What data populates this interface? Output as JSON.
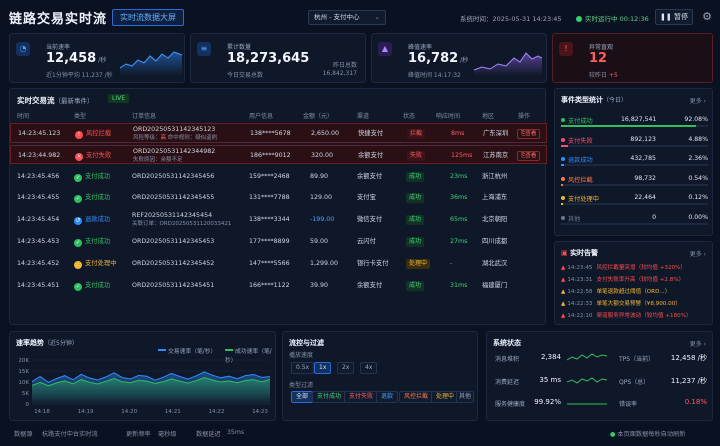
{
  "header": {
    "title": "链路交易实时流",
    "tag": "实时流数据大屏",
    "region": "杭州 - 支付中心",
    "system_time_label": "系统时间：",
    "system_time": "2025-05-31 14:23:45",
    "running_label": "实时运行中",
    "running_time": "00:12:36",
    "pause_label": "暂停"
  },
  "kpis": [
    {
      "label": "当前速率",
      "value": "12,458",
      "unit": "/秒",
      "sub": "近1分钟平均  11,237 /秒",
      "icon": "speed-icon",
      "color": "#2f8cff"
    },
    {
      "label": "累计数量",
      "value": "18,273,645",
      "unit": "",
      "sub": "今日交易总数",
      "right_label": "昨日总数",
      "right_value": "16,842,317",
      "icon": "database-icon",
      "color": "#2f8cff"
    },
    {
      "label": "峰值速率",
      "value": "16,782",
      "unit": "/秒",
      "sub": "峰值时间  14:17:32",
      "icon": "peak-icon",
      "color": "#9b6cff"
    },
    {
      "label": "异常直观",
      "value": "12",
      "unit": "",
      "sub": "较昨日",
      "delta": "+5",
      "icon": "alert-icon",
      "color": "#ff4d4f"
    }
  ],
  "live": {
    "title": "实时交易流",
    "subtitle": "（最新事件）",
    "badge": "LIVE",
    "columns": [
      "时间",
      "类型",
      "订单信息",
      "用户信息",
      "金额（元）",
      "渠道",
      "状态",
      "响应时间",
      "地区",
      "操作"
    ],
    "rows": [
      {
        "time": "14:23:45.123",
        "type": "风控拦截",
        "tcolor": "#ff4d4f",
        "tglyph": "!",
        "order": "ORD20250531142345123",
        "note_pre": "风险等级：",
        "note_hl": "高",
        "note_post": "  命中规则：疑似盗刷",
        "user": "138****5678",
        "amount": "2,650.00",
        "channel": "快捷支付",
        "status": "拦截",
        "sclass": "p-bad",
        "resp": "8ms",
        "rcolor": "#ff5d5d",
        "region": "广东深圳",
        "op": "查看",
        "bad": true
      },
      {
        "time": "14:23:44.982",
        "type": "支付失败",
        "tcolor": "#ff4d4f",
        "tglyph": "✕",
        "order": "ORD20250531142344982",
        "note_pre": "失败原因：余额不足",
        "note_hl": "",
        "note_post": "",
        "user": "186****9012",
        "amount": "320.00",
        "channel": "余额支付",
        "status": "失败",
        "sclass": "p-bad",
        "resp": "125ms",
        "rcolor": "#ff5d5d",
        "region": "江苏南京",
        "op": "查看",
        "bad": true
      },
      {
        "time": "14:23:45.456",
        "type": "支付成功",
        "tcolor": "#2fbf5f",
        "tglyph": "✓",
        "order": "ORD20250531142345456",
        "note_pre": "",
        "note_hl": "",
        "note_post": "",
        "user": "159****2468",
        "amount": "89.90",
        "channel": "余额支付",
        "status": "成功",
        "sclass": "p-ok",
        "resp": "23ms",
        "rcolor": "#3fd47b",
        "region": "浙江杭州",
        "op": "",
        "bad": false
      },
      {
        "time": "14:23:45.455",
        "type": "支付成功",
        "tcolor": "#2fbf5f",
        "tglyph": "✓",
        "order": "ORD20250531142345455",
        "note_pre": "",
        "note_hl": "",
        "note_post": "",
        "user": "131****7788",
        "amount": "129.00",
        "channel": "支付宝",
        "status": "成功",
        "sclass": "p-ok",
        "resp": "36ms",
        "rcolor": "#3fd47b",
        "region": "上海浦东",
        "op": "",
        "bad": false
      },
      {
        "time": "14:23:45.454",
        "type": "退款成功",
        "tcolor": "#2f8cff",
        "tglyph": "↺",
        "order": "REF20250531142345454",
        "note_pre": "关联订单：ORD20250531120033421",
        "note_hl": "",
        "note_post": "",
        "user": "138****3344",
        "amount": "-199.00",
        "acolor": "#4da3ff",
        "channel": "微信支付",
        "status": "成功",
        "sclass": "p-ok",
        "resp": "65ms",
        "rcolor": "#3fd47b",
        "region": "北京朝阳",
        "op": "",
        "bad": false
      },
      {
        "time": "14:23:45.453",
        "type": "支付成功",
        "tcolor": "#2fbf5f",
        "tglyph": "✓",
        "order": "ORD20250531142345453",
        "note_pre": "",
        "note_hl": "",
        "note_post": "",
        "user": "177****8899",
        "amount": "59.00",
        "channel": "云闪付",
        "status": "成功",
        "sclass": "p-ok",
        "resp": "27ms",
        "rcolor": "#3fd47b",
        "region": "四川成都",
        "op": "",
        "bad": false
      },
      {
        "time": "14:23:45.452",
        "type": "支付处理中",
        "tcolor": "#f2b531",
        "tglyph": "…",
        "order": "ORD20250531142345452",
        "note_pre": "",
        "note_hl": "",
        "note_post": "",
        "user": "147****5566",
        "amount": "1,299.00",
        "channel": "银行卡支付",
        "status": "处理中",
        "sclass": "p-warn",
        "resp": "-",
        "rcolor": "#9aa7bf",
        "region": "湖北武汉",
        "op": "",
        "bad": false
      },
      {
        "time": "14:23:45.451",
        "type": "支付成功",
        "tcolor": "#2fbf5f",
        "tglyph": "✓",
        "order": "ORD20250531142345451",
        "note_pre": "",
        "note_hl": "",
        "note_post": "",
        "user": "166****1122",
        "amount": "39.90",
        "channel": "余额支付",
        "status": "成功",
        "sclass": "p-ok",
        "resp": "31ms",
        "rcolor": "#3fd47b",
        "region": "福建厦门",
        "op": "",
        "bad": false
      }
    ]
  },
  "stats": {
    "title": "事件类型统计",
    "subtitle": "（今日）",
    "more": "更多 ›",
    "items": [
      {
        "name": "支付成功",
        "count": "16,827,541",
        "pct": "92.08%",
        "color": "#2fbf5f",
        "frac": 0.9208
      },
      {
        "name": "支付失败",
        "count": "892,123",
        "pct": "4.88%",
        "color": "#ff4d6d",
        "frac": 0.0488
      },
      {
        "name": "退款成功",
        "count": "432,785",
        "pct": "2.36%",
        "color": "#2f8cff",
        "frac": 0.0236
      },
      {
        "name": "风控拦截",
        "count": "98,732",
        "pct": "0.54%",
        "color": "#ff7a45",
        "frac": 0.0054
      },
      {
        "name": "支付处理中",
        "count": "22,464",
        "pct": "0.12%",
        "color": "#f2b531",
        "frac": 0.0012
      },
      {
        "name": "其他",
        "count": "0",
        "pct": "0.00%",
        "color": "#6b7890",
        "frac": 0
      }
    ]
  },
  "alerts": {
    "title": "实时告警",
    "more": "更多 ›",
    "items": [
      {
        "time": "14:23:45",
        "text": "风控拦截量突增（较均值 +320%）",
        "color": "#ff4d4f",
        "icon": "warning-icon"
      },
      {
        "time": "14:23:31",
        "text": "支付失败率升高（较均值 +2.8%）",
        "color": "#ff4d4f",
        "icon": "warning-icon"
      },
      {
        "time": "14:22:58",
        "text": "单笔退款超过阈值（ORD...）",
        "color": "#f2b531",
        "icon": "warning-icon"
      },
      {
        "time": "14:22:33",
        "text": "单笔大额交易预警（¥8,900.00）",
        "color": "#f2b531",
        "icon": "warning-icon"
      },
      {
        "time": "14:22:10",
        "text": "渠道服务异常波动（较均值 +180%）",
        "color": "#ff4d4f",
        "icon": "warning-icon"
      }
    ]
  },
  "trend": {
    "title": "速率趋势",
    "subtitle": "（近5分钟）",
    "legend": [
      "交易速率（笔/秒）",
      "成功速率（笔/秒）"
    ]
  },
  "chart_data": {
    "type": "area",
    "ylim": [
      0,
      20000
    ],
    "yticks": [
      "20K",
      "15K",
      "10K",
      "5K",
      "0"
    ],
    "xticks": [
      "14:18",
      "14:19",
      "14:20",
      "14:21",
      "14:22",
      "14:23"
    ],
    "series": [
      {
        "name": "交易速率（笔/秒）",
        "color": "#2f8cff",
        "values": [
          10200,
          12500,
          9800,
          11600,
          12900,
          11000,
          13500,
          11800,
          10900,
          12300,
          14200,
          12000,
          11400,
          13000,
          12600,
          10800,
          12200,
          13900,
          12500,
          11300,
          12800,
          14600,
          13100,
          11900,
          12700,
          11500,
          12900,
          13400,
          12100,
          12458
        ]
      },
      {
        "name": "成功速率（笔/秒）",
        "color": "#2fbf5f",
        "values": [
          8500,
          9800,
          8300,
          9600,
          10500,
          9200,
          11100,
          9900,
          9100,
          10300,
          11600,
          10100,
          9700,
          10800,
          10400,
          9300,
          10200,
          11400,
          10400,
          9500,
          10600,
          12000,
          10900,
          10000,
          10500,
          9700,
          10700,
          11100,
          10100,
          11237
        ]
      }
    ]
  },
  "filter": {
    "title": "流控与过滤",
    "speed_label": "播放速度",
    "speeds": [
      "0.5x",
      "1x",
      "2x",
      "4x"
    ],
    "type_label": "类型过滤",
    "types": [
      "全部",
      "支付成功",
      "支付失败",
      "退款",
      "风控拦截",
      "处理中",
      "其他"
    ]
  },
  "system": {
    "title": "系统状态",
    "more": "更多 ›",
    "metrics": [
      {
        "label": "消息堆积",
        "value": "2,384"
      },
      {
        "label": "消费延迟",
        "value": "35 ms"
      },
      {
        "label": "服务健康度",
        "value": "99.92%"
      },
      {
        "label": "TPS（当前）",
        "value": "12,458 /秒"
      },
      {
        "label": "QPS（总）",
        "value": "11,237 /秒"
      },
      {
        "label": "错误率",
        "value": "0.18%"
      }
    ]
  },
  "footer": {
    "source_label": "数据源",
    "source": "杭路支付中台实时流",
    "refresh_label": "更新频率",
    "refresh": "毫秒级",
    "latency_label": "数据延迟",
    "latency": "35ms",
    "note": "本页面数据每秒自动刷新"
  }
}
